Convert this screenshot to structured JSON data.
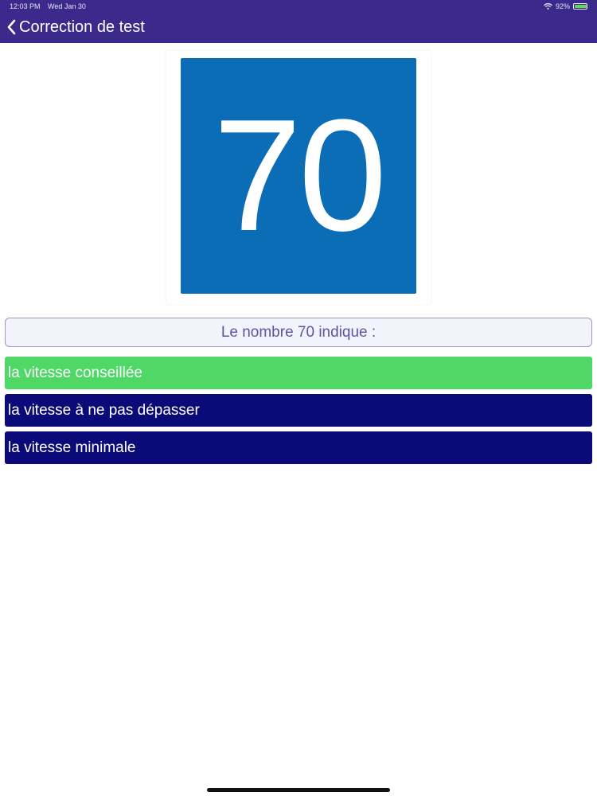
{
  "status": {
    "time": "12:03 PM",
    "date": "Wed Jan 30",
    "battery": "92%"
  },
  "nav": {
    "back_icon": "chevron-left-icon",
    "title": "Correction de test"
  },
  "sign": {
    "number": "70",
    "color": "#0a6db6"
  },
  "question": {
    "text": "Le nombre 70 indique :"
  },
  "answers": [
    {
      "label": "la vitesse conseillée",
      "state": "correct",
      "color": "#4fd866"
    },
    {
      "label": "la vitesse à ne pas dépasser",
      "state": "neutral",
      "color": "#0a0a78"
    },
    {
      "label": "la vitesse minimale",
      "state": "neutral",
      "color": "#0a0a78"
    }
  ],
  "colors": {
    "header": "#3b2a8c",
    "question_text": "#5a55a6"
  }
}
